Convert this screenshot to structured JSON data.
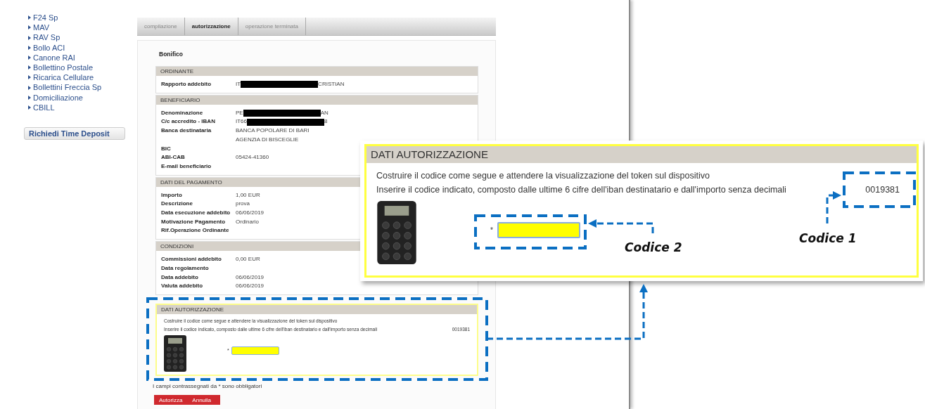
{
  "sidebar": {
    "items": [
      "F24 Sp",
      "MAV",
      "RAV Sp",
      "Bollo ACI",
      "Canone RAI",
      "Bollettino Postale",
      "Ricarica Cellulare",
      "Bollettini Freccia Sp",
      "Domiciliazione",
      "CBILL"
    ],
    "button": "Richiedi Time Deposit"
  },
  "steps": [
    {
      "label": "compilazione",
      "selected": false
    },
    {
      "label": "autorizzazione",
      "selected": true
    },
    {
      "label": "operazione terminata",
      "selected": false
    }
  ],
  "page_title": "Bonifico",
  "sections": [
    {
      "title": "ORDINANTE",
      "rows": [
        {
          "label": "Rapporto addebito",
          "value": "IT",
          "redacted": true,
          "value_end": "CRISTIAN"
        }
      ]
    },
    {
      "title": "BENEFICIARIO",
      "rows": [
        {
          "label": "Denominazione",
          "value": "PE",
          "redacted": true,
          "value_end": "AN"
        },
        {
          "label": "C/c accredito - IBAN",
          "value": "IT66",
          "redacted": true,
          "value_end": "8"
        },
        {
          "label": "Banca destinataria",
          "value_lines": [
            "BANCA POPOLARE DI BARI",
            "AGENZIA DI BISCEGLIE"
          ]
        },
        {
          "label": "BIC"
        },
        {
          "label": "ABI-CAB",
          "value": "05424-41360"
        },
        {
          "label": "E-mail beneficiario"
        }
      ]
    },
    {
      "title": "DATI DEL PAGAMENTO",
      "rows": [
        {
          "label": "Importo",
          "value": "1,00 EUR"
        },
        {
          "label": "Descrizione",
          "value": "prova"
        },
        {
          "label": "Data esecuzione addebito",
          "value": "06/06/2019"
        },
        {
          "label": "Motivazione Pagamento",
          "value": "Ordinario"
        },
        {
          "label": "Rif.Operazione Ordinante"
        }
      ]
    },
    {
      "title": "CONDIZIONI",
      "rows": [
        {
          "label": "Commissioni addebito",
          "value": "0,00 EUR"
        },
        {
          "label": "Data regolamento"
        },
        {
          "label": "Data addebito",
          "value": "06/06/2019"
        },
        {
          "label": "Valuta addebito",
          "value": "06/06/2019"
        }
      ]
    }
  ],
  "authorization": {
    "title": "DATI AUTORIZZAZIONE",
    "instructions": [
      "Costruire il codice come segue e attendere la visualizzazione del token sul dispositivo",
      "Inserire il codice indicato, composto dalle ultime 6 cifre dell'iban destinatario e dall'importo senza decimali"
    ],
    "code": "0019381",
    "required_mark": "*"
  },
  "required_note": "I campi contrassegnati da * sono obbligatori",
  "buttons": [
    "Autorizza",
    "Annulla"
  ],
  "callout": {
    "title": "DATI AUTORIZZAZIONE",
    "instructions": [
      "Costruire il codice come segue e attendere la visualizzazione del token sul dispositivo",
      "Inserire il codice indicato, composto dalle ultime 6 cifre dell'iban destinatario e dall'importo senza decimali"
    ],
    "code": "0019381",
    "required_mark": "*"
  },
  "annotations": [
    {
      "label": "Codice 2"
    },
    {
      "label": "Codice 1"
    }
  ]
}
